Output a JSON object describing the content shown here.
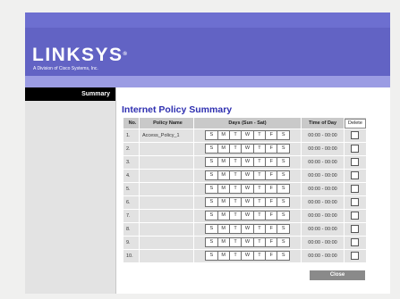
{
  "brand": {
    "name": "LINKSYS",
    "trademark": "®",
    "tagline": "A Division of Cisco Systems, Inc."
  },
  "colors": {
    "header": "#6263c4",
    "topbar": "#6d6fd0",
    "subbar": "#9b9ce3",
    "title": "#2e2fb0",
    "tab_active": "#000000"
  },
  "sidebar": {
    "active_tab": "Summary"
  },
  "main": {
    "title": "Internet Policy Summary",
    "columns": {
      "no": "No.",
      "policy_name": "Policy Name",
      "days": "Days (Sun - Sat)",
      "time": "Time of Day",
      "delete_button": "Delete"
    },
    "day_letters": [
      "S",
      "M",
      "T",
      "W",
      "T",
      "F",
      "S"
    ],
    "rows": [
      {
        "no": "1.",
        "policy_name": "Access_Policy_1",
        "time": "00:00 - 00:00",
        "checked": false
      },
      {
        "no": "2.",
        "policy_name": "",
        "time": "00:00 - 00:00",
        "checked": false
      },
      {
        "no": "3.",
        "policy_name": "",
        "time": "00:00 - 00:00",
        "checked": false
      },
      {
        "no": "4.",
        "policy_name": "",
        "time": "00:00 - 00:00",
        "checked": false
      },
      {
        "no": "5.",
        "policy_name": "",
        "time": "00:00 - 00:00",
        "checked": false
      },
      {
        "no": "6.",
        "policy_name": "",
        "time": "00:00 - 00:00",
        "checked": false
      },
      {
        "no": "7.",
        "policy_name": "",
        "time": "00:00 - 00:00",
        "checked": false
      },
      {
        "no": "8.",
        "policy_name": "",
        "time": "00:00 - 00:00",
        "checked": false
      },
      {
        "no": "9.",
        "policy_name": "",
        "time": "00:00 - 00:00",
        "checked": false
      },
      {
        "no": "10.",
        "policy_name": "",
        "time": "00:00 - 00:00",
        "checked": false
      }
    ],
    "close_label": "Close"
  }
}
